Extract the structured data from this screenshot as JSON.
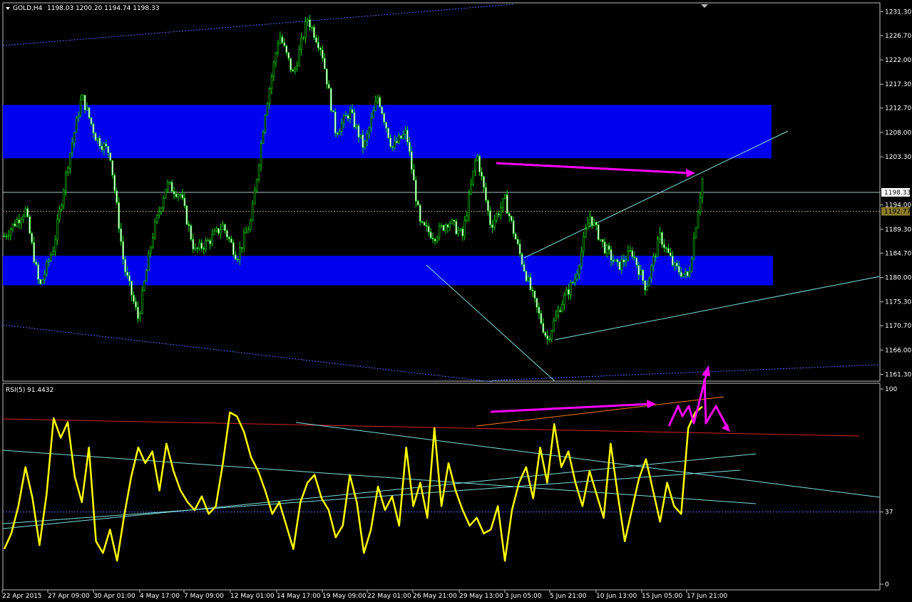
{
  "header": {
    "symbol_label": "GOLD,H4",
    "ohlc_label": "1198.03 1200.20 1194.74 1198.33"
  },
  "indicator": {
    "label": "RSI(5)",
    "value_label": "91.4432"
  },
  "colors": {
    "background": "#000000",
    "frame": "#c0c0c0",
    "candle": "#00e000",
    "zone": "#0000ee",
    "trendline": "#7fdfdf",
    "channel": "#4a6cff",
    "annotation": "#ff00ff",
    "rsi_line": "#ffff00",
    "rsi_red": "#dc2020",
    "rsi_orange": "#ff7a00"
  },
  "chart_data": [
    {
      "type": "line",
      "title": "GOLD,H4",
      "y_axis_ticks": [
        "1231.30",
        "1226.70",
        "1222.00",
        "1217.30",
        "1212.70",
        "1208.00",
        "1203.30",
        "1198.33",
        "1194.00",
        "1192.77",
        "1189.30",
        "1184.70",
        "1180.00",
        "1175.30",
        "1170.70",
        "1166.00",
        "1161.30"
      ],
      "y_values": [
        1231.3,
        1226.7,
        1222.0,
        1217.3,
        1212.7,
        1208.0,
        1203.3,
        1194.0,
        1189.3,
        1184.7,
        1180.0,
        1175.3,
        1170.7,
        1166.0,
        1161.3
      ],
      "current_price": 1198.33,
      "secondary_price": 1192.77,
      "ylim": [
        1160.0,
        1233.0
      ],
      "x_tick_labels": [
        "22 Apr 2015",
        "27 Apr 09:00",
        "30 Apr 01:00",
        "4 May 17:00",
        "7 May 09:00",
        "12 May 01:00",
        "14 May 17:00",
        "19 May 09:00",
        "22 May 01:00",
        "26 May 21:00",
        "29 May 13:00",
        "3 Jun 05:00",
        "5 Jun 21:00",
        "10 Jun 13:00",
        "15 Jun 05:00",
        "17 Jun 21:00"
      ],
      "price_path_keypoints": [
        [
          0,
          1188
        ],
        [
          3,
          1193
        ],
        [
          5,
          1178
        ],
        [
          7,
          1186
        ],
        [
          9,
          1202
        ],
        [
          11,
          1215
        ],
        [
          13,
          1207
        ],
        [
          15,
          1204
        ],
        [
          17,
          1182
        ],
        [
          19,
          1172
        ],
        [
          21,
          1188
        ],
        [
          23,
          1198
        ],
        [
          25,
          1196
        ],
        [
          27,
          1185
        ],
        [
          29,
          1187
        ],
        [
          31,
          1190
        ],
        [
          33,
          1184
        ],
        [
          35,
          1191
        ],
        [
          37,
          1212
        ],
        [
          39,
          1227
        ],
        [
          41,
          1219
        ],
        [
          43,
          1230
        ],
        [
          45,
          1224
        ],
        [
          47,
          1208
        ],
        [
          49,
          1212
        ],
        [
          51,
          1205
        ],
        [
          53,
          1215
        ],
        [
          55,
          1205
        ],
        [
          57,
          1208
        ],
        [
          59,
          1190
        ],
        [
          61,
          1188
        ],
        [
          63,
          1191
        ],
        [
          65,
          1188
        ],
        [
          67,
          1204
        ],
        [
          69,
          1190
        ],
        [
          71,
          1195
        ],
        [
          73,
          1185
        ],
        [
          75,
          1176
        ],
        [
          77,
          1168
        ],
        [
          79,
          1175
        ],
        [
          81,
          1180
        ],
        [
          83,
          1192
        ],
        [
          85,
          1186
        ],
        [
          87,
          1182
        ],
        [
          89,
          1185
        ],
        [
          91,
          1178
        ],
        [
          93,
          1188
        ],
        [
          95,
          1182
        ],
        [
          97,
          1180
        ],
        [
          99,
          1199
        ]
      ],
      "zones": [
        {
          "low": 1203.0,
          "high": 1213.3
        },
        {
          "low": 1178.5,
          "high": 1184.2
        }
      ]
    },
    {
      "type": "line",
      "title": "RSI(5)",
      "y_axis_ticks": [
        "100",
        "37",
        "0"
      ],
      "ylim": [
        0,
        100
      ],
      "levels": [
        37
      ],
      "last_value": 91.4432,
      "values": [
        18,
        26,
        40,
        60,
        44,
        20,
        46,
        85,
        75,
        83,
        55,
        42,
        70,
        22,
        16,
        28,
        12,
        35,
        55,
        70,
        62,
        68,
        48,
        72,
        58,
        48,
        42,
        38,
        45,
        36,
        40,
        62,
        88,
        86,
        78,
        65,
        58,
        48,
        36,
        42,
        30,
        18,
        42,
        52,
        56,
        44,
        38,
        24,
        30,
        56,
        42,
        16,
        28,
        50,
        38,
        45,
        30,
        70,
        40,
        52,
        34,
        80,
        40,
        62,
        48,
        38,
        30,
        34,
        26,
        28,
        40,
        12,
        38,
        52,
        60,
        44,
        70,
        52,
        82,
        60,
        68,
        52,
        40,
        58,
        46,
        34,
        72,
        46,
        22,
        38,
        54,
        64,
        48,
        32,
        52,
        40,
        36,
        80,
        88,
        91
      ]
    }
  ]
}
